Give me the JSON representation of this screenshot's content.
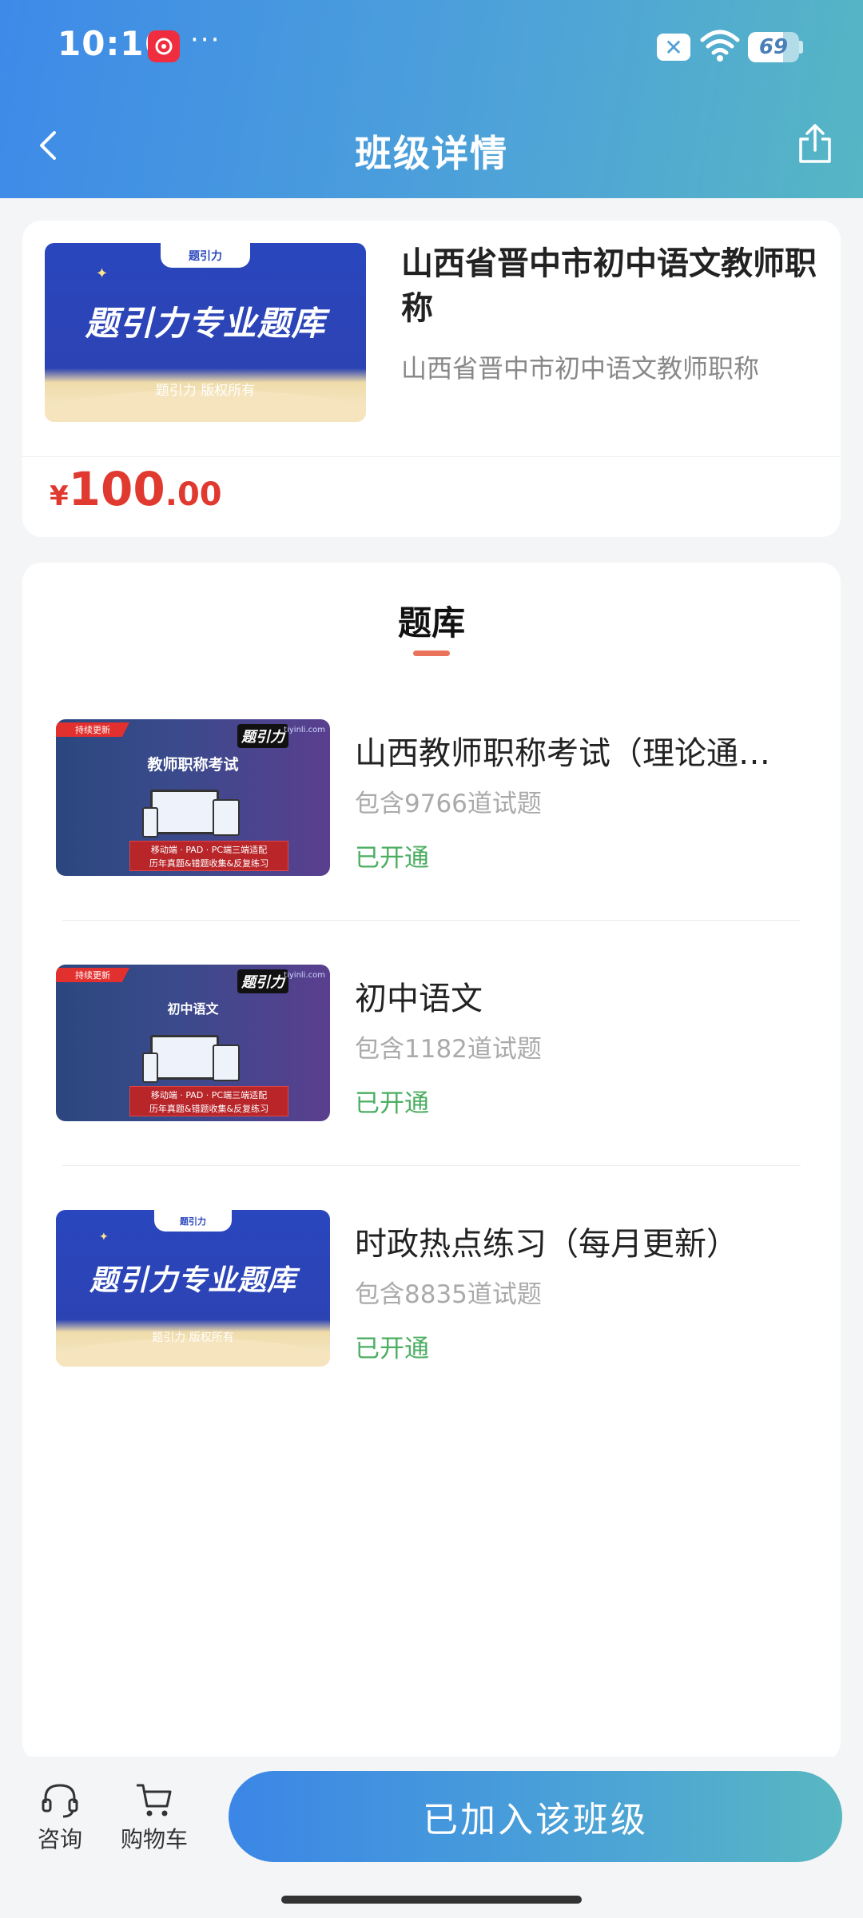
{
  "status_bar": {
    "time": "10:16",
    "battery": "69",
    "more": "···"
  },
  "nav": {
    "title": "班级详情"
  },
  "course": {
    "title": "山西省晋中市初中语文教师职称",
    "subtitle": "山西省晋中市初中语文教师职称",
    "price_currency": "¥",
    "price_int": "100",
    "price_dec": ".00",
    "thumb_main": "题引力专业题库",
    "thumb_sub": "题引力 版权所有",
    "thumb_tab": "题引力"
  },
  "section": {
    "title": "题库"
  },
  "banks": [
    {
      "title": "山西教师职称考试（理论通…",
      "count": "包含9766道试题",
      "status": "已开通",
      "thumb": {
        "ribbon": "持续更新",
        "logo": "题引力",
        "url": "tiyinli.com",
        "title": "教师职称考试",
        "banner_line1": "移动端 · PAD · PC端三端适配",
        "banner_line2": "历年真题&错题收集&反复练习"
      }
    },
    {
      "title": "初中语文",
      "count": "包含1182道试题",
      "status": "已开通",
      "thumb": {
        "ribbon": "持续更新",
        "logo": "题引力",
        "url": "tiyinli.com",
        "title": "初中语文",
        "banner_line1": "移动端 · PAD · PC端三端适配",
        "banner_line2": "历年真题&错题收集&反复练习"
      }
    },
    {
      "title": "时政热点练习（每月更新）",
      "count": "包含8835道试题",
      "status": "已开通",
      "thumb": {
        "main": "题引力专业题库",
        "sub": "题引力 版权所有",
        "tab": "题引力"
      }
    }
  ],
  "bottom": {
    "consult": "咨询",
    "cart": "购物车",
    "join": "已加入该班级"
  },
  "colors": {
    "accent_blue": "#3d8ae8",
    "price_red": "#e0392f",
    "status_green": "#4cae62",
    "tab_underline": "#e9735a"
  }
}
